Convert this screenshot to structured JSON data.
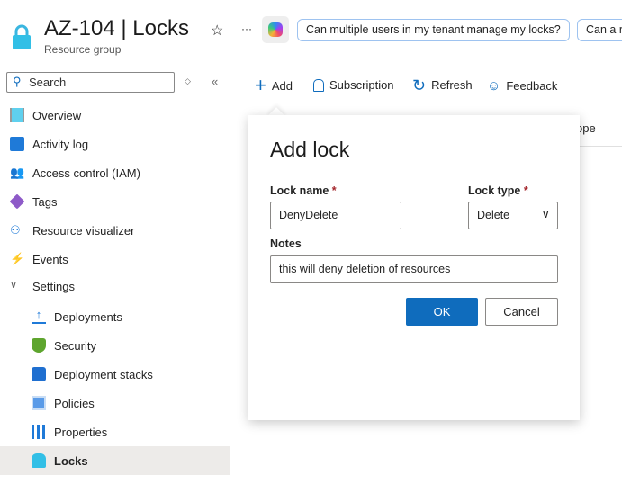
{
  "header": {
    "title": "AZ-104 | Locks",
    "subtitle": "Resource group",
    "suggestions": [
      "Can multiple users in my tenant manage my locks?",
      "Can a r"
    ]
  },
  "sidebar": {
    "search_placeholder": "Search",
    "items": [
      {
        "label": "Overview"
      },
      {
        "label": "Activity log"
      },
      {
        "label": "Access control (IAM)"
      },
      {
        "label": "Tags"
      },
      {
        "label": "Resource visualizer"
      },
      {
        "label": "Events"
      },
      {
        "label": "Settings"
      },
      {
        "label": "Deployments"
      },
      {
        "label": "Security"
      },
      {
        "label": "Deployment stacks"
      },
      {
        "label": "Policies"
      },
      {
        "label": "Properties"
      },
      {
        "label": "Locks"
      }
    ]
  },
  "toolbar": {
    "add": "Add",
    "subscription": "Subscription",
    "refresh": "Refresh",
    "feedback": "Feedback"
  },
  "table": {
    "partial_header": "ope"
  },
  "dialog": {
    "title": "Add lock",
    "lock_name_label": "Lock name",
    "lock_name_value": "DenyDelete",
    "lock_type_label": "Lock type",
    "lock_type_value": "Delete",
    "notes_label": "Notes",
    "notes_value": "this will deny deletion of resources",
    "ok": "OK",
    "cancel": "Cancel",
    "required": "*"
  },
  "colors": {
    "accent": "#0f6cbd"
  }
}
